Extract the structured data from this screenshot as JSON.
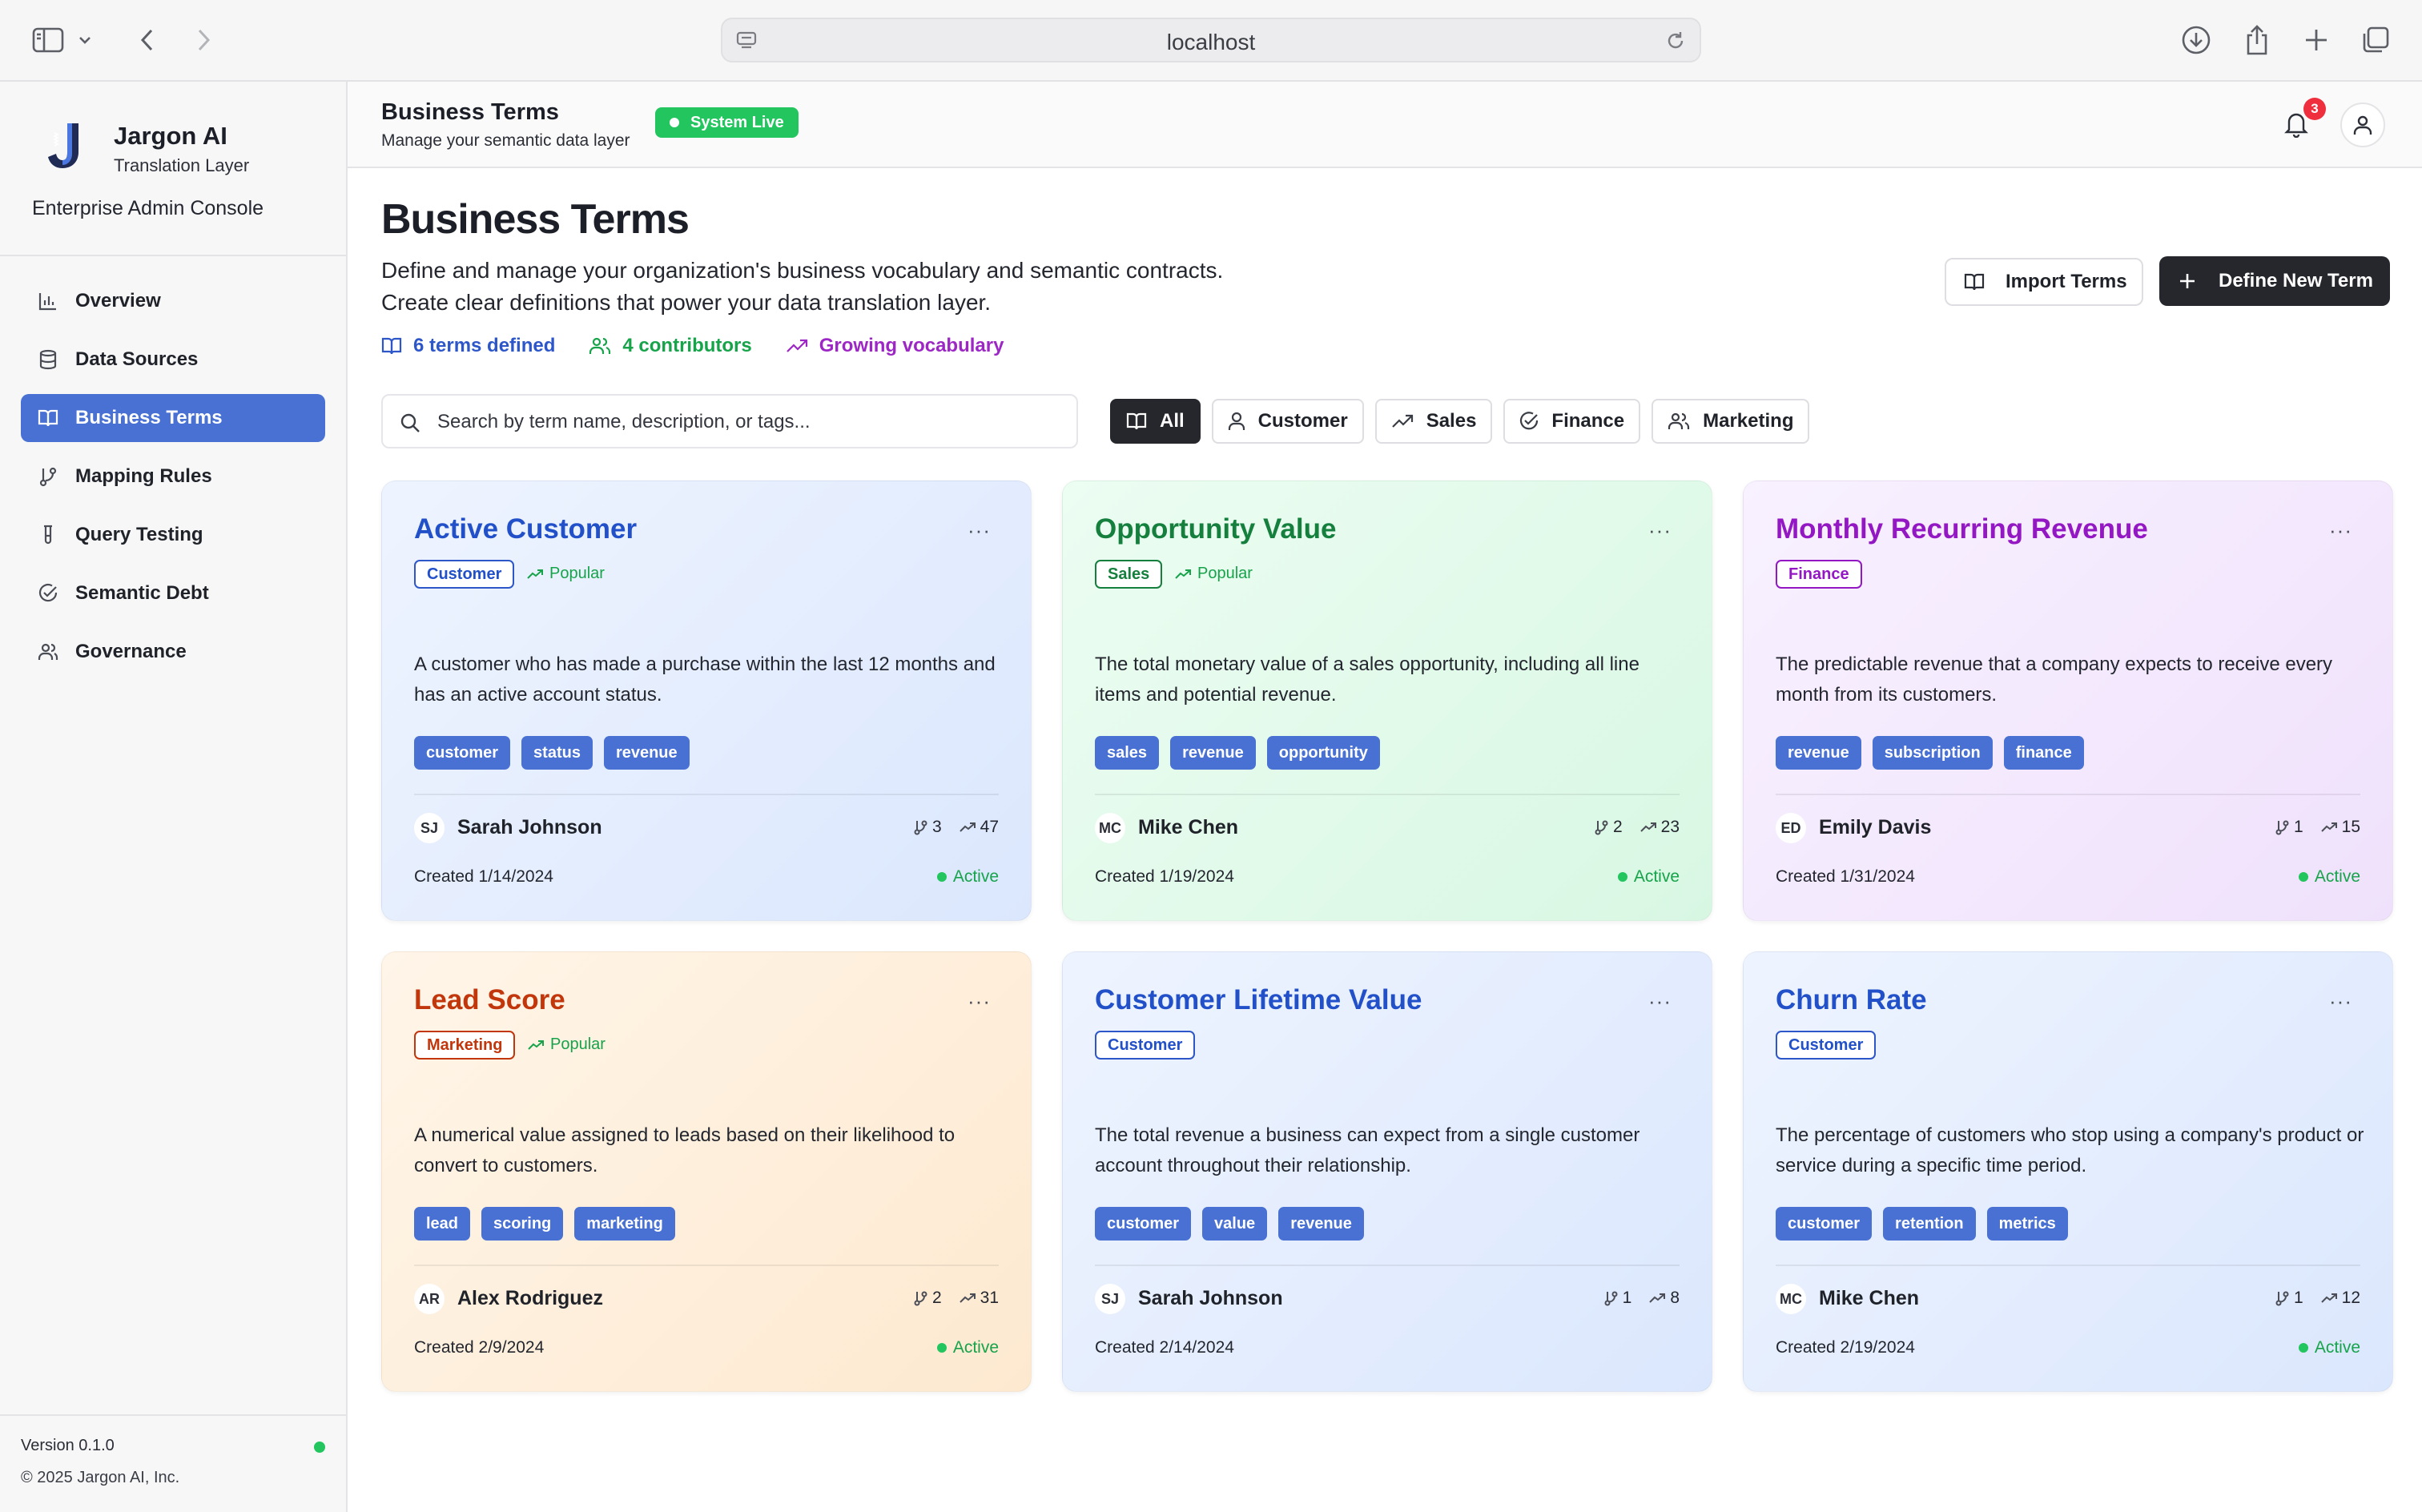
{
  "browser": {
    "url": "localhost"
  },
  "brand": {
    "name": "Jargon AI",
    "subtitle": "Translation Layer",
    "console": "Enterprise Admin Console"
  },
  "sidebar": {
    "items": [
      {
        "label": "Overview",
        "icon": "bar-chart-icon",
        "active": false
      },
      {
        "label": "Data Sources",
        "icon": "database-icon",
        "active": false
      },
      {
        "label": "Business Terms",
        "icon": "book-icon",
        "active": true
      },
      {
        "label": "Mapping Rules",
        "icon": "git-branch-icon",
        "active": false
      },
      {
        "label": "Query Testing",
        "icon": "test-tube-icon",
        "active": false
      },
      {
        "label": "Semantic Debt",
        "icon": "check-circle-icon",
        "active": false
      },
      {
        "label": "Governance",
        "icon": "users-icon",
        "active": false
      }
    ],
    "version": "Version 0.1.0",
    "copyright": "© 2025 Jargon AI, Inc."
  },
  "header": {
    "title": "Business Terms",
    "subtitle": "Manage your semantic data layer",
    "status_badge": "System Live",
    "notifications": "3"
  },
  "page": {
    "title": "Business Terms",
    "description_line1": "Define and manage your organization's business vocabulary and semantic contracts.",
    "description_line2": "Create clear definitions that power your data translation layer.",
    "stats": {
      "terms": "6 terms defined",
      "contributors": "4 contributors",
      "growth": "Growing vocabulary"
    },
    "import_button": "Import Terms",
    "define_button": "Define New Term"
  },
  "search": {
    "placeholder": "Search by term name, description, or tags...",
    "value": ""
  },
  "filters": [
    {
      "label": "All",
      "icon": "book-icon",
      "active": true
    },
    {
      "label": "Customer",
      "icon": "user-icon",
      "active": false
    },
    {
      "label": "Sales",
      "icon": "trending-up-icon",
      "active": false
    },
    {
      "label": "Finance",
      "icon": "check-circle-icon",
      "active": false
    },
    {
      "label": "Marketing",
      "icon": "users-icon",
      "active": false
    }
  ],
  "cards": [
    {
      "title": "Active Customer",
      "category": "Customer",
      "popular": "Popular",
      "description": "A customer who has made a purchase within the last 12 months and has an active account status.",
      "tags": [
        "customer",
        "status",
        "revenue"
      ],
      "initials": "SJ",
      "author": "Sarah Johnson",
      "branches": "3",
      "usage": "47",
      "created": "Created 1/14/2024",
      "status": "Active",
      "theme": "blue"
    },
    {
      "title": "Opportunity Value",
      "category": "Sales",
      "popular": "Popular",
      "description": "The total monetary value of a sales opportunity, including all line items and potential revenue.",
      "tags": [
        "sales",
        "revenue",
        "opportunity"
      ],
      "initials": "MC",
      "author": "Mike Chen",
      "branches": "2",
      "usage": "23",
      "created": "Created 1/19/2024",
      "status": "Active",
      "theme": "green"
    },
    {
      "title": "Monthly Recurring Revenue",
      "category": "Finance",
      "popular": "",
      "description": "The predictable revenue that a company expects to receive every month from its customers.",
      "tags": [
        "revenue",
        "subscription",
        "finance"
      ],
      "initials": "ED",
      "author": "Emily Davis",
      "branches": "1",
      "usage": "15",
      "created": "Created 1/31/2024",
      "status": "Active",
      "theme": "purple"
    },
    {
      "title": "Lead Score",
      "category": "Marketing",
      "popular": "Popular",
      "description": "A numerical value assigned to leads based on their likelihood to convert to customers.",
      "tags": [
        "lead",
        "scoring",
        "marketing"
      ],
      "initials": "AR",
      "author": "Alex Rodriguez",
      "branches": "2",
      "usage": "31",
      "created": "Created 2/9/2024",
      "status": "Active",
      "theme": "orange"
    },
    {
      "title": "Customer Lifetime Value",
      "category": "Customer",
      "popular": "",
      "description": "The total revenue a business can expect from a single customer account throughout their relationship.",
      "tags": [
        "customer",
        "value",
        "revenue"
      ],
      "initials": "SJ",
      "author": "Sarah Johnson",
      "branches": "1",
      "usage": "8",
      "created": "Created 2/14/2024",
      "status": "",
      "theme": "blue"
    },
    {
      "title": "Churn Rate",
      "category": "Customer",
      "popular": "",
      "description": "The percentage of customers who stop using a company's product or service during a specific time period.",
      "tags": [
        "customer",
        "retention",
        "metrics"
      ],
      "initials": "MC",
      "author": "Mike Chen",
      "branches": "1",
      "usage": "12",
      "created": "Created 2/19/2024",
      "status": "Active",
      "theme": "blue"
    }
  ]
}
